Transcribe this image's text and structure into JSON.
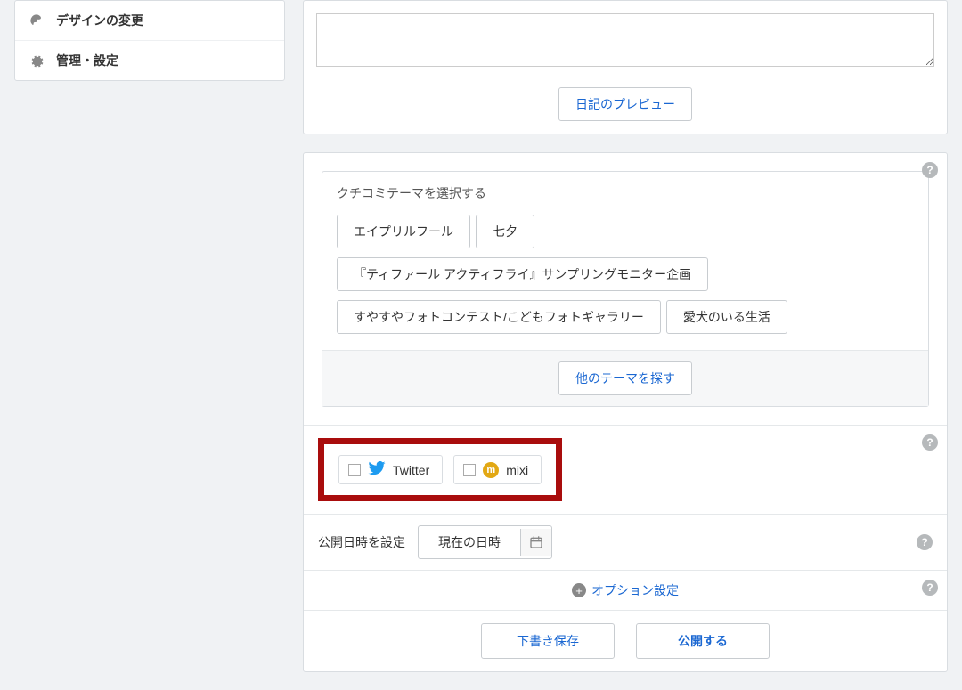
{
  "sidebar": {
    "items": [
      {
        "icon": "palette",
        "label": "デザインの変更"
      },
      {
        "icon": "gear",
        "label": "管理・設定"
      }
    ]
  },
  "editor": {
    "preview_button": "日記のプレビュー"
  },
  "themes": {
    "heading": "クチコミテーマを選択する",
    "items": [
      "エイプリルフール",
      "七夕",
      "『ティファール アクティフライ』サンプリングモニター企画",
      "すやすやフォトコンテスト/こどもフォトギャラリー",
      "愛犬のいる生活"
    ],
    "more_button": "他のテーマを探す"
  },
  "share": {
    "twitter": "Twitter",
    "mixi": "mixi"
  },
  "datetime": {
    "label": "公開日時を設定",
    "value": "現在の日時"
  },
  "options": {
    "label": "オプション設定"
  },
  "actions": {
    "draft": "下書き保存",
    "publish": "公開する"
  },
  "help_badge": "?"
}
